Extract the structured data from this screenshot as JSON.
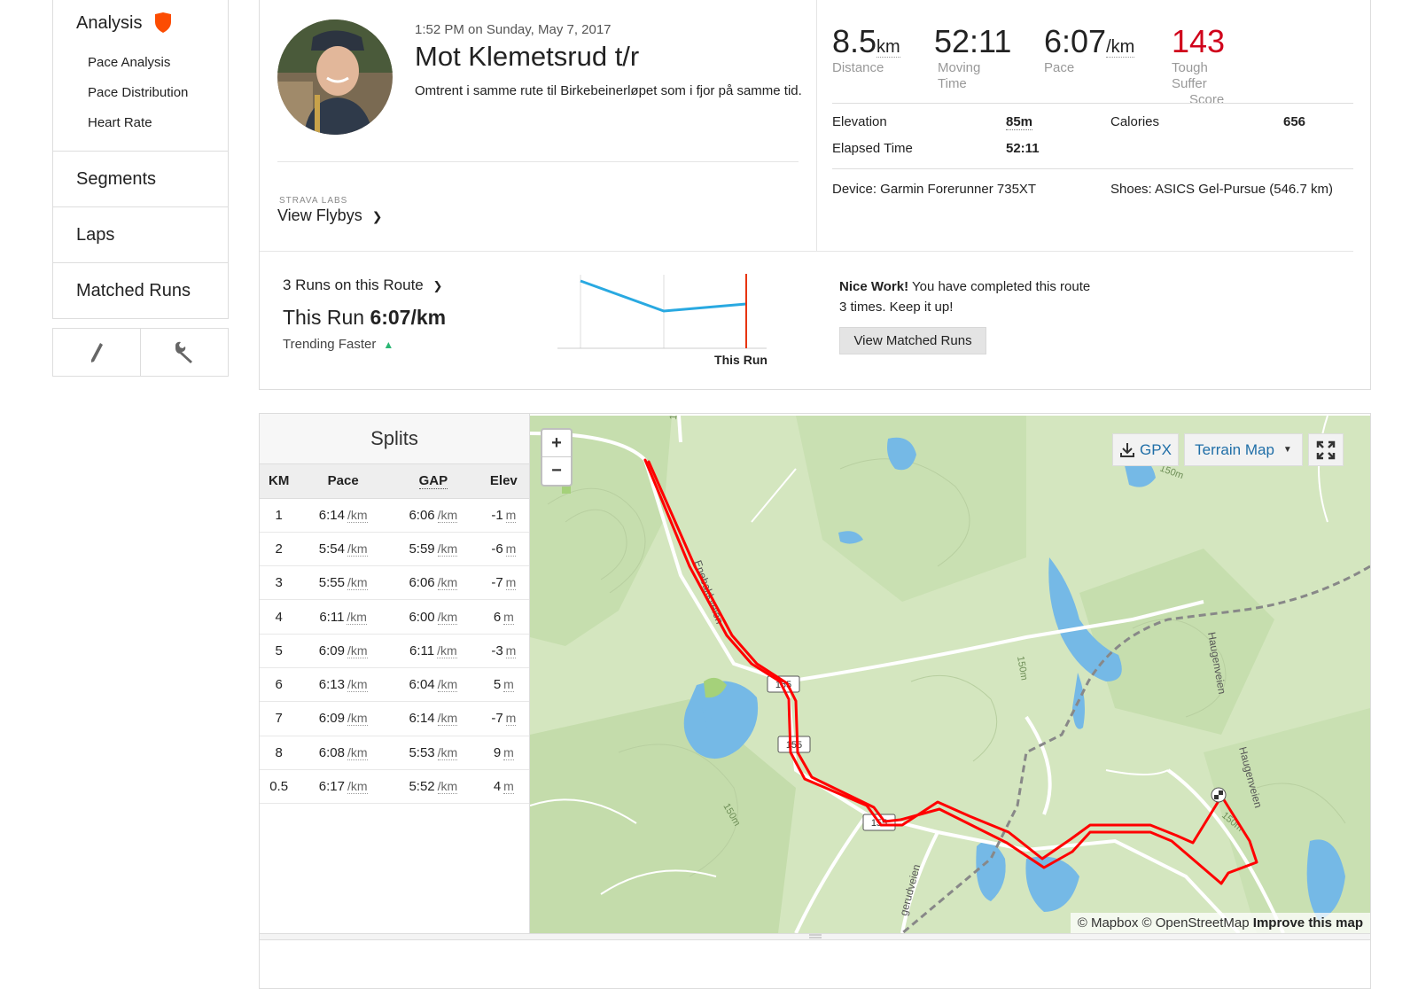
{
  "sidebar": {
    "analysis_label": "Analysis",
    "sub_items": [
      {
        "label": "Pace Analysis"
      },
      {
        "label": "Pace Distribution"
      },
      {
        "label": "Heart Rate"
      }
    ],
    "items": [
      {
        "label": "Segments"
      },
      {
        "label": "Laps"
      },
      {
        "label": "Matched Runs"
      }
    ],
    "tools": [
      "pencil-icon",
      "wrench-icon"
    ]
  },
  "activity": {
    "date": "1:52 PM on Sunday, May 7, 2017",
    "title": "Mot Klemetsrud t/r",
    "description": "Omtrent i samme rute til Birkebeinerløpet som i fjor på samme tid.",
    "labs_label": "STRAVA LABS",
    "flybys_link": "View Flybys"
  },
  "stats": {
    "distance": {
      "value": "8.5",
      "unit": "km",
      "label": "Distance"
    },
    "moving_time": {
      "value": "52:11",
      "label": "Moving Time"
    },
    "pace": {
      "value": "6:07",
      "unit": "/km",
      "label": "Pace"
    },
    "suffer": {
      "value": "143",
      "label_line1": "Tough Suffer",
      "label_line2": "Score"
    },
    "elevation_label": "Elevation",
    "elevation_value": "85m",
    "calories_label": "Calories",
    "calories_value": "656",
    "elapsed_label": "Elapsed Time",
    "elapsed_value": "52:11",
    "device": "Device: Garmin Forerunner 735XT",
    "shoes": "Shoes: ASICS Gel-Pursue (546.7 km)"
  },
  "route": {
    "runs_on_route": "3 Runs on this Route",
    "this_run_prefix": "This Run ",
    "this_run_pace": "6:07/km",
    "trending": "Trending Faster",
    "chart_label": "This Run",
    "nice_bold": "Nice Work!",
    "nice_text": " You have completed this route 3 times. Keep it up!",
    "button": "View Matched Runs"
  },
  "splits": {
    "title": "Splits",
    "headers": [
      "KM",
      "Pace",
      "GAP",
      "Elev"
    ],
    "pace_unit": "/km",
    "elev_unit": "m",
    "rows": [
      {
        "km": "1",
        "pace": "6:14",
        "gap": "6:06",
        "elev": "-1"
      },
      {
        "km": "2",
        "pace": "5:54",
        "gap": "5:59",
        "elev": "-6"
      },
      {
        "km": "3",
        "pace": "5:55",
        "gap": "6:06",
        "elev": "-7"
      },
      {
        "km": "4",
        "pace": "6:11",
        "gap": "6:00",
        "elev": "6"
      },
      {
        "km": "5",
        "pace": "6:09",
        "gap": "6:11",
        "elev": "-3"
      },
      {
        "km": "6",
        "pace": "6:13",
        "gap": "6:04",
        "elev": "5"
      },
      {
        "km": "7",
        "pace": "6:09",
        "gap": "6:14",
        "elev": "-7"
      },
      {
        "km": "8",
        "pace": "6:08",
        "gap": "5:53",
        "elev": "9"
      },
      {
        "km": "0.5",
        "pace": "6:17",
        "gap": "5:52",
        "elev": "4"
      }
    ]
  },
  "map": {
    "zoom_in": "+",
    "zoom_out": "−",
    "gpx": "GPX",
    "terrain": "Terrain Map",
    "attribution": "© Mapbox © OpenStreetMap ",
    "improve": "Improve this map",
    "road_labels": [
      "Enebakkveien",
      "Haugenveien",
      "Haugenveien",
      "gerudveien",
      "155",
      "155",
      "155",
      "150m",
      "150m",
      "150m",
      "150m",
      "150m"
    ],
    "colors": {
      "route": "#ff0000",
      "water": "#75b9e6",
      "land": "#d4e6bf"
    }
  },
  "colors": {
    "accent": "#fc4c02",
    "suffer": "#d0021b",
    "link": "#1f6ea7",
    "trend_up": "#2ab673",
    "trend_line": "#29a9e1"
  }
}
